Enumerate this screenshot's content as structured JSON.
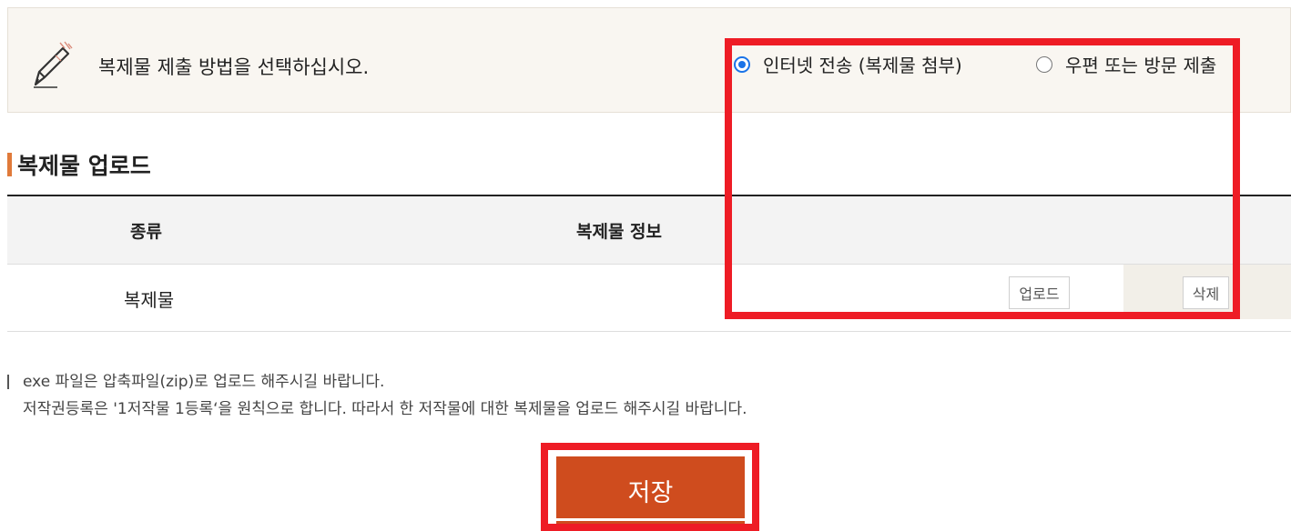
{
  "notice": {
    "icon": "pencil-icon",
    "text": "복제물 제출 방법을 선택하십시오.",
    "options": [
      {
        "label": "인터넷 전송 (복제물 첨부)",
        "checked": true
      },
      {
        "label": "우편 또는 방문 제출",
        "checked": false
      }
    ]
  },
  "upload_section": {
    "title": "복제물 업로드",
    "accent_color": "#e07a3a",
    "columns": [
      "종류",
      "복제물 정보"
    ],
    "row": {
      "label": "복제물",
      "upload_label": "업로드",
      "delete_label": "삭제"
    }
  },
  "notes": [
    "exe 파일은 압축파일(zip)로 업로드 해주시길 바랍니다.",
    "저작권등록은 '1저작물 1등록‘을 원칙으로 합니다. 따라서 한 저작물에 대한 복제물을 업로드 해주시길 바랍니다."
  ],
  "save_label": "저장",
  "colors": {
    "save_button": "#cf4c1e",
    "highlight": "#ee1c25",
    "radio_checked": "#1a73e8"
  }
}
